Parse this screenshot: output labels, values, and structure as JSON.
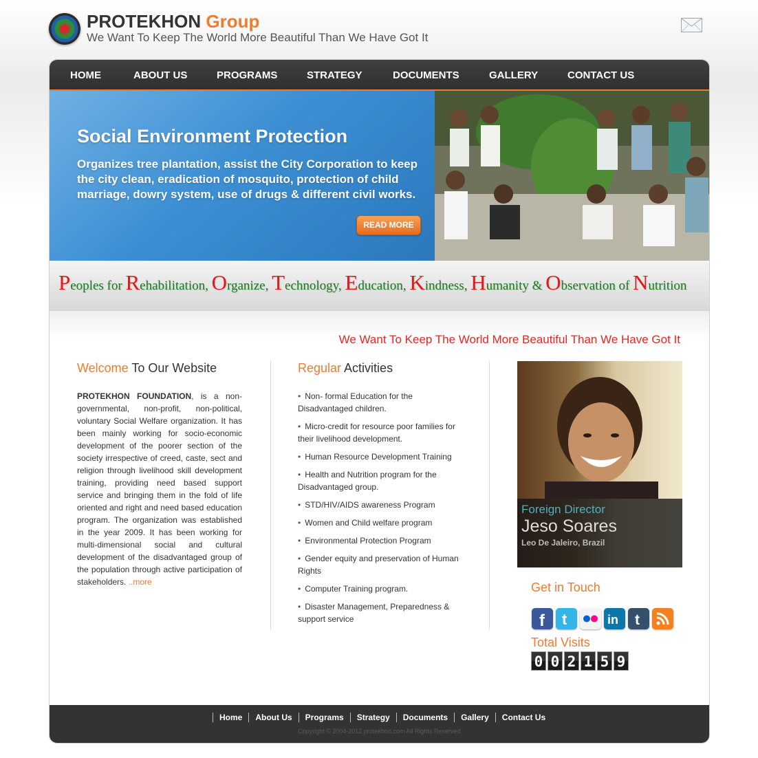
{
  "header": {
    "brand_main": "PROTEKHON",
    "brand_accent": "Group",
    "tagline": "We Want To Keep The World More Beautiful Than We Have Got It",
    "mail_icon": "envelope-icon"
  },
  "nav": {
    "items": [
      "HOME",
      "ABOUT US",
      "PROGRAMS",
      "STRATEGY",
      "DOCUMENTS",
      "GALLERY",
      "CONTACT US"
    ]
  },
  "hero": {
    "title": "Social Environment Protection",
    "text": "Organizes tree plantation, assist the City Corporation to keep the city clean, eradication of mosquito, protection of child marriage, dowry system, use of drugs & different civil works.",
    "read_more": "READ MORE"
  },
  "acronym": {
    "words": [
      {
        "cap": "P",
        "rest": "eoples for "
      },
      {
        "cap": "R",
        "rest": "ehabilitation, "
      },
      {
        "cap": "O",
        "rest": "rganize, "
      },
      {
        "cap": "T",
        "rest": "echnology, "
      },
      {
        "cap": "E",
        "rest": "ducation, "
      },
      {
        "cap": "K",
        "rest": "indness, "
      },
      {
        "cap": "H",
        "rest": "umanity & "
      },
      {
        "cap": "O",
        "rest": "bservation of "
      },
      {
        "cap": "N",
        "rest": "utrition"
      }
    ]
  },
  "slogan": "We Want To Keep The World More Beautiful Than We Have Got It",
  "welcome": {
    "title_accent": "Welcome",
    "title_rest": " To Our Website",
    "org_name": "PROTEKHON FOUNDATION",
    "body": ", is a non-governmental, non-profit, non-political, voluntary Social Welfare organization. It has been mainly working for socio-economic development of the poorer section of the society irrespective of creed, caste, sect and religion through livelihood skill development training, providing need based support service and bringing them in the fold of life oriented and right and need based education program. The organization was established in the year 2009. It has been working for multi-dimensional social and cultural development of the disadvantaged group of the population through active participation of stakeholders. ",
    "more_link": "..more"
  },
  "activities": {
    "title_accent": "Regular",
    "title_rest": " Activities",
    "items": [
      "Non- formal Education for the Disadvantaged children.",
      "Micro-credit for resource poor families for their livelihood development.",
      "Human Resource Development Training",
      "Health and Nutrition program for the Disadvantaged group.",
      "STD/HIV/AIDS awareness Program",
      "Women and Child welfare program",
      "Environmental Protection Program",
      "Gender equity and preservation of Human Rights",
      "Computer Training program.",
      "Disaster Management, Preparedness & support service"
    ]
  },
  "director": {
    "role": "Foreign Director",
    "name": "Jeso Soares",
    "location": "Leo De Jaleiro, Brazil"
  },
  "contact": {
    "get_in_touch": "Get in Touch",
    "social_icons": [
      "facebook-icon",
      "twitter-icon",
      "flickr-icon",
      "linkedin-icon",
      "tumblr-icon",
      "rss-icon"
    ],
    "total_visits_label": "Total Visits",
    "visit_digits": [
      "0",
      "0",
      "2",
      "1",
      "5",
      "9"
    ]
  },
  "footer": {
    "links": [
      "Home",
      "About Us",
      "Programs",
      "Strategy",
      "Documents",
      "Gallery",
      "Contact Us"
    ],
    "copyright": "Copyright © 2004-2012 protekhon.com All Rights Reserved."
  },
  "colors": {
    "accent_orange": "#ef7b2f",
    "nav_dark": "#333333",
    "slogan_red": "#e8251d",
    "acronym_green": "#1e7a1e",
    "acronym_red": "#e01a1a"
  }
}
